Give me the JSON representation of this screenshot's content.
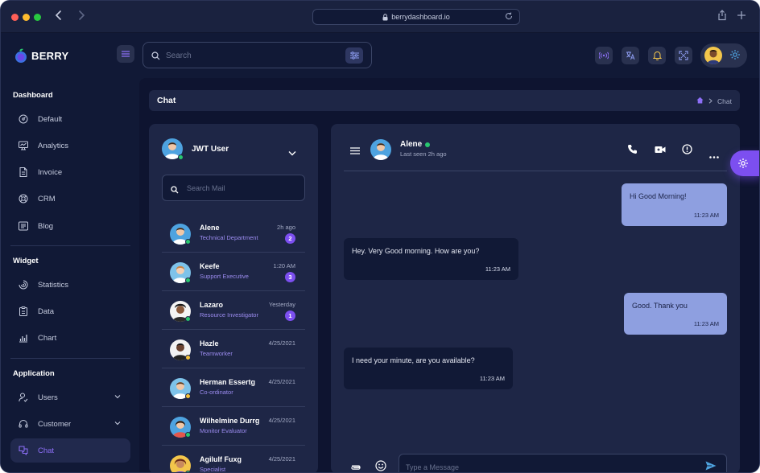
{
  "browser": {
    "url": "berrydashboard.io"
  },
  "app": {
    "brand": "BERRY",
    "search_placeholder": "Search",
    "accent": "#7c4ff0"
  },
  "sidebar": {
    "sections": [
      {
        "title": "Dashboard",
        "items": [
          {
            "label": "Default",
            "icon": "dashboard-icon"
          },
          {
            "label": "Analytics",
            "icon": "device-analytics-icon"
          },
          {
            "label": "Invoice",
            "icon": "file-invoice-icon"
          },
          {
            "label": "CRM",
            "icon": "lifebuoy-icon"
          },
          {
            "label": "Blog",
            "icon": "news-icon"
          }
        ]
      },
      {
        "title": "Widget",
        "items": [
          {
            "label": "Statistics",
            "icon": "chart-arcs-icon"
          },
          {
            "label": "Data",
            "icon": "clipboard-list-icon"
          },
          {
            "label": "Chart",
            "icon": "chart-bar-icon"
          }
        ]
      },
      {
        "title": "Application",
        "items": [
          {
            "label": "Users",
            "icon": "user-check-icon"
          },
          {
            "label": "Customer",
            "icon": "headset-icon"
          },
          {
            "label": "Chat",
            "icon": "messages-icon",
            "active": true
          }
        ]
      }
    ]
  },
  "breadcrumb": {
    "title": "Chat",
    "current": "Chat"
  },
  "users_panel": {
    "me": {
      "name": "JWT User"
    },
    "search_placeholder": "Search Mail",
    "users": [
      {
        "name": "Alene",
        "role": "Technical Department",
        "time": "2h ago",
        "unread": "2",
        "status": "online",
        "avatar_bg": "#4ea3e0"
      },
      {
        "name": "Keefe",
        "role": "Support Executive",
        "time": "1:20 AM",
        "unread": "3",
        "status": "online",
        "avatar_bg": "#7ec3ea"
      },
      {
        "name": "Lazaro",
        "role": "Resource Investigator",
        "time": "Yesterday",
        "unread": "1",
        "status": "online",
        "avatar_bg": "#f4f4f4"
      },
      {
        "name": "Hazle",
        "role": "Teamworker",
        "time": "4/25/2021",
        "unread": "",
        "status": "away",
        "avatar_bg": "#f2f2f2"
      },
      {
        "name": "Herman Essertg",
        "role": "Co-ordinator",
        "time": "4/25/2021",
        "unread": "",
        "status": "away",
        "avatar_bg": "#7ec3ea"
      },
      {
        "name": "Wilhelmine Durrg",
        "role": "Monitor Evaluator",
        "time": "4/25/2021",
        "unread": "",
        "status": "online",
        "avatar_bg": "#4ea3e0"
      },
      {
        "name": "Agilulf Fuxg",
        "role": "Specialist",
        "time": "4/25/2021",
        "unread": "",
        "status": "online",
        "avatar_bg": "#f3c64b"
      }
    ]
  },
  "chat": {
    "name": "Alene",
    "last_seen": "Last seen 2h ago",
    "messages": [
      {
        "text": "Hi Good Morning!",
        "time": "11:23 AM",
        "direction": "out"
      },
      {
        "text": "Hey. Very Good morning. How are you?",
        "time": "11:23 AM",
        "direction": "in"
      },
      {
        "text": "Good. Thank you",
        "time": "11:23 AM",
        "direction": "out"
      },
      {
        "text": "I need your minute, are you available?",
        "time": "11:23 AM",
        "direction": "in"
      }
    ],
    "compose_placeholder": "Type a Message"
  }
}
